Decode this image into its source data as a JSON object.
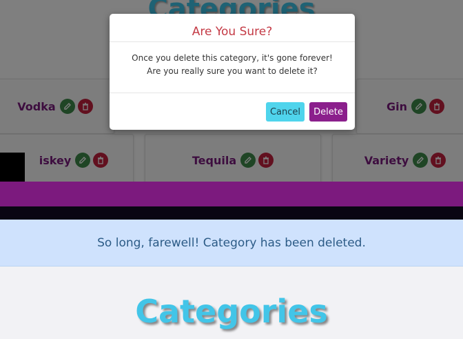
{
  "background": {
    "title": "Categories",
    "categories": [
      {
        "name": "Vodka"
      },
      {
        "name": "Gin"
      },
      {
        "name": "iskey"
      },
      {
        "name": "Tequila"
      },
      {
        "name": "Variety"
      }
    ]
  },
  "modal": {
    "title": "Are You Sure?",
    "line1": "Once you delete this category, it's gone forever!",
    "line2": "Are you really sure you want to delete it?",
    "cancel_label": "Cancel",
    "delete_label": "Delete"
  },
  "alert": {
    "message": "So long, farewell! Category has been deleted."
  },
  "page": {
    "title": "Categories"
  },
  "colors": {
    "brand_purple": "#7c1a7e",
    "title_cyan": "#42c5e8",
    "alert_bg": "#cfe2fd",
    "edit_green": "#3e8a4a",
    "delete_red": "#c4203f"
  },
  "icons": [
    "edit-icon",
    "trash-icon"
  ]
}
